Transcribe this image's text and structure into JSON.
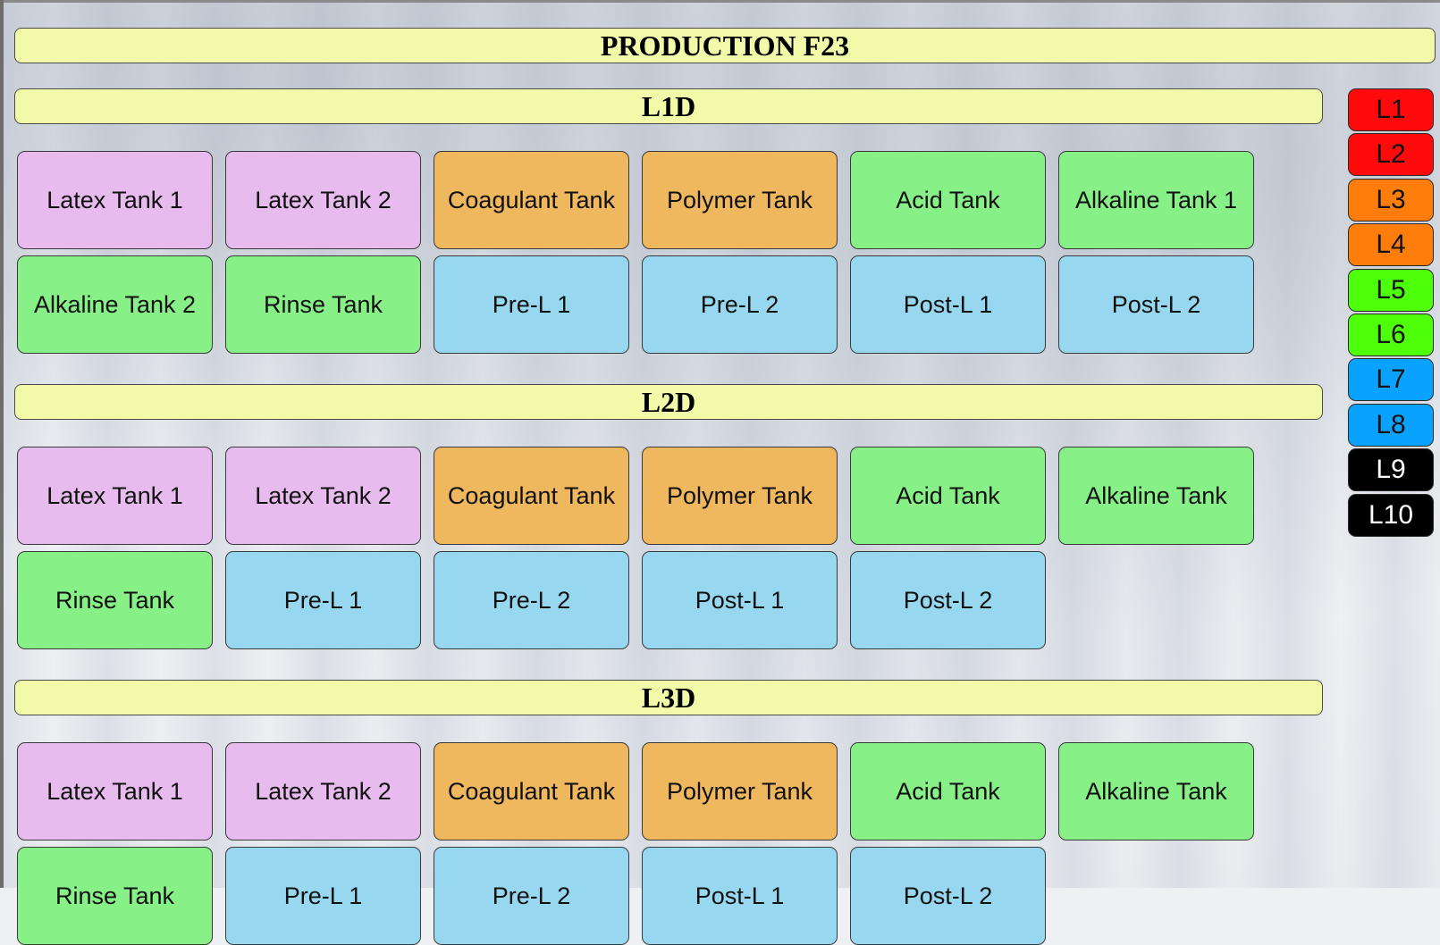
{
  "page_title": "PRODUCTION F23",
  "colors": {
    "latex": "#e8bbee",
    "coagulant": "#efb75e",
    "rinse_acid_alkaline": "#87f087",
    "pre_post": "#97d8f0",
    "banner": "#f2f9a8"
  },
  "sections": [
    {
      "title": "L1D",
      "tiles": [
        "Latex Tank 1",
        "Latex Tank 2",
        "Coagulant Tank",
        "Polymer Tank",
        "Acid Tank",
        "Alkaline Tank 1",
        "Alkaline Tank 2",
        "Rinse Tank",
        "Pre-L 1",
        "Pre-L 2",
        "Post-L 1",
        "Post-L 2"
      ]
    },
    {
      "title": "L2D",
      "tiles": [
        "Latex Tank 1",
        "Latex Tank 2",
        "Coagulant Tank",
        "Polymer Tank",
        "Acid Tank",
        "Alkaline Tank",
        "Rinse Tank",
        "Pre-L 1",
        "Pre-L 2",
        "Post-L 1",
        "Post-L 2"
      ]
    },
    {
      "title": "L3D",
      "tiles": [
        "Latex Tank 1",
        "Latex Tank 2",
        "Coagulant Tank",
        "Polymer Tank",
        "Acid Tank",
        "Alkaline Tank",
        "Rinse Tank",
        "Pre-L 1",
        "Pre-L 2",
        "Post-L 1",
        "Post-L 2"
      ]
    }
  ],
  "line_buttons": [
    {
      "label": "L1",
      "color": "#ff0a0a",
      "text_color": "#111111"
    },
    {
      "label": "L2",
      "color": "#ff0a0a",
      "text_color": "#111111"
    },
    {
      "label": "L3",
      "color": "#ff7d0a",
      "text_color": "#111111"
    },
    {
      "label": "L4",
      "color": "#ff7d0a",
      "text_color": "#111111"
    },
    {
      "label": "L5",
      "color": "#4dff0a",
      "text_color": "#111111"
    },
    {
      "label": "L6",
      "color": "#4dff0a",
      "text_color": "#111111"
    },
    {
      "label": "L7",
      "color": "#0aa2ff",
      "text_color": "#111111"
    },
    {
      "label": "L8",
      "color": "#0aa2ff",
      "text_color": "#111111"
    },
    {
      "label": "L9",
      "color": "#000000",
      "text_color": "#ffffff"
    },
    {
      "label": "L10",
      "color": "#000000",
      "text_color": "#ffffff"
    }
  ]
}
